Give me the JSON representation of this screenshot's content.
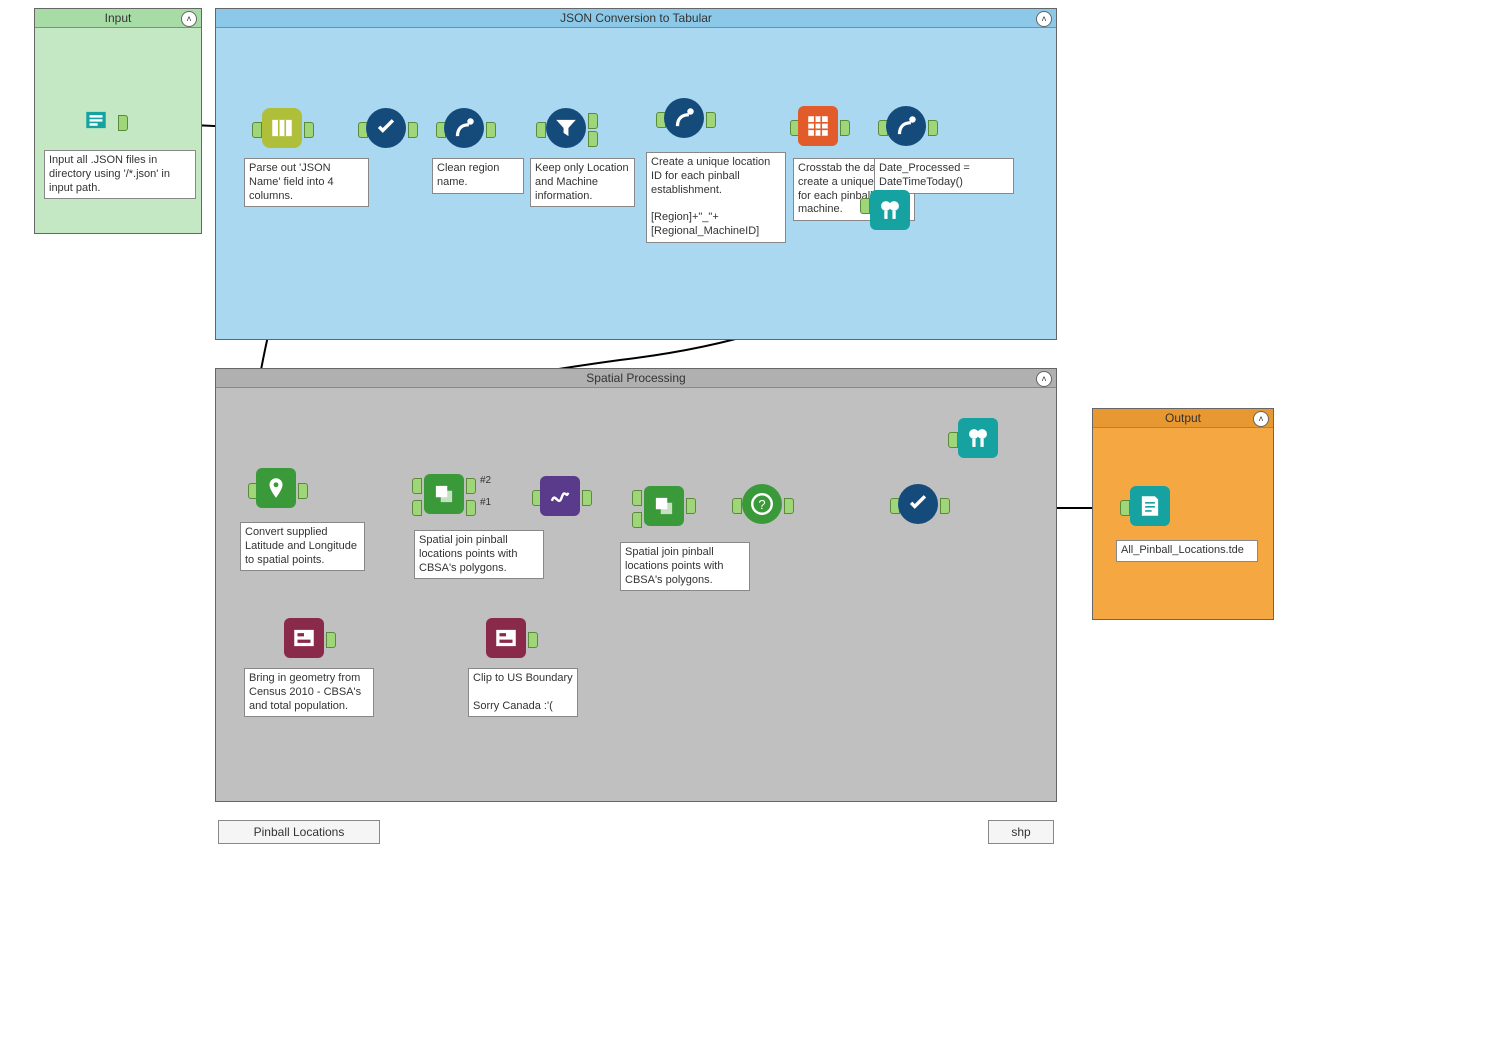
{
  "containers": {
    "input": {
      "title": "Input"
    },
    "json": {
      "title": "JSON Conversion to Tabular"
    },
    "spatial": {
      "title": "Spatial Processing"
    },
    "output": {
      "title": "Output"
    }
  },
  "annotations": {
    "input_desc": "Input all .JSON files in directory using '/*.json' in input path.",
    "parse_json": "Parse out 'JSON Name' field into 4 columns.",
    "clean_region": "Clean region name.",
    "keep_only": "Keep only Location and Machine information.",
    "unique_id": "Create a unique location ID for each pinball establishment.\n\n[Region]+\"_\"+[Regional_MachineID]",
    "crosstab": "Crosstab the data to create a unique record for each pinball machine.",
    "date_proc": "Date_Processed = DateTimeToday()",
    "convert_ll": "Convert supplied Latitude and Longitude to spatial points.",
    "census": "Bring in geometry from Census 2010 - CBSA's and total population.",
    "spatial_join1": "Spatial join pinball locations points with CBSA's polygons.",
    "clip_us": "Clip to US Boundary\n\nSorry Canada :'(",
    "spatial_join2": "Spatial join pinball locations points with CBSA's polygons.",
    "output_file": "All_Pinball_Locations.tde"
  },
  "labels": {
    "match2": "#2",
    "match1": "#1"
  },
  "tabs": {
    "pinball": "Pinball Locations",
    "shp": "shp"
  },
  "icons": {
    "input": "input-data-icon",
    "parse": "text-to-columns-icon",
    "select": "select-icon",
    "formula": "formula-icon",
    "filter": "filter-icon",
    "crosstab": "crosstab-icon",
    "browse": "browse-icon",
    "createpoints": "create-points-icon",
    "spatialmatch": "spatial-match-icon",
    "spatialinput": "spatial-input-icon",
    "generalize": "generalize-icon",
    "spatialinfo": "spatial-info-icon",
    "output": "output-data-icon"
  }
}
